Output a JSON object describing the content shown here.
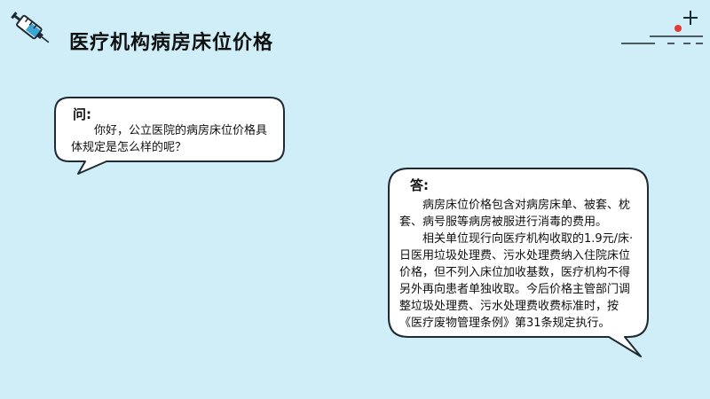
{
  "slide": {
    "title": "医疗机构病房床位价格"
  },
  "question": {
    "label": "问:",
    "text": "你好，公立医院的病房床位价格具体规定是怎么样的呢？"
  },
  "answer": {
    "label": "答:",
    "paragraphs": [
      "病房床位价格包含对病房床单、被套、枕套、病号服等病房被服进行消毒的费用。",
      "相关单位现行向医疗机构收取的1.9元/床·日医用垃圾处理费、污水处理费纳入住院床位价格，但不列入床位加收基数，医疗机构不得另外再向患者单独收取。今后价格主管部门调整垃圾处理费、污水处理费收费标准时，按《医疗废物管理条例》第31条规定执行。"
    ]
  },
  "colors": {
    "background": "#cfeef8",
    "bubble_fill": "#ffffff",
    "outline": "#1f2a33",
    "syringe_liquid": "#3aa6d8",
    "decor_red": "#e53935"
  },
  "icons": {
    "syringe": "syringe-icon",
    "decoration": "plus-dot-dashes-decor"
  }
}
